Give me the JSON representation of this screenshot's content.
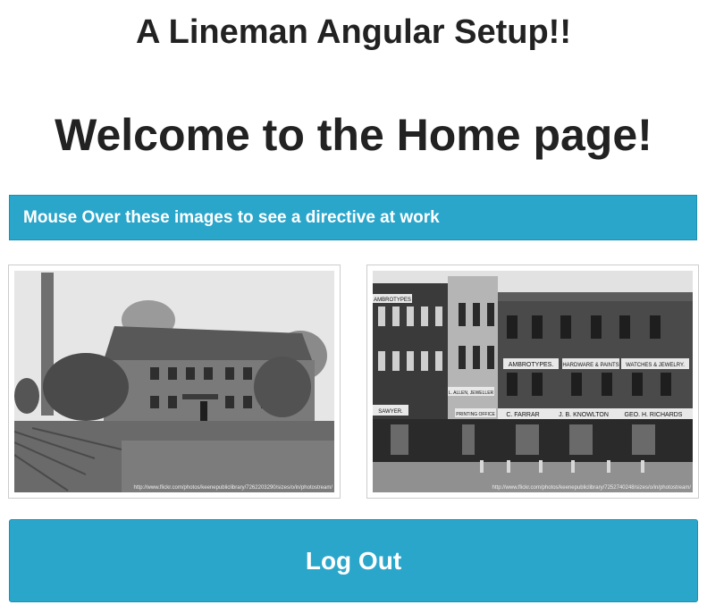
{
  "app_title": "A Lineman Angular Setup!!",
  "page_heading": "Welcome to the Home page!",
  "banner": {
    "text": "Mouse Over these images to see a directive at work",
    "color": "#2ba6cb"
  },
  "images": [
    {
      "alt": "Old brick mill building with chimney and field",
      "caption": "http://www.flickr.com/photos/keenepubliclibrary/7262203290/sizes/o/in/photostream/"
    },
    {
      "alt": "Historic downtown storefront buildings",
      "caption": "http://www.flickr.com/photos/keenepubliclibrary/7252740248/sizes/o/in/photostream/",
      "signs": {
        "ambrotypes_top": "AMBROTYPES",
        "ambrotypes": "AMBROTYPES.",
        "hardware": "HARDWARE & PAINTS",
        "watches": "WATCHES & JEWELRY.",
        "allen": "L. ALLEN, JEWELLER",
        "printing": "PRINTING OFFICE",
        "sawyer": "SAWYER.",
        "farrar": "C. FARRAR",
        "knowlton": "J. B. KNOWLTON",
        "richards": "GEO. H. RICHARDS"
      }
    }
  ],
  "logout": {
    "label": "Log Out"
  }
}
